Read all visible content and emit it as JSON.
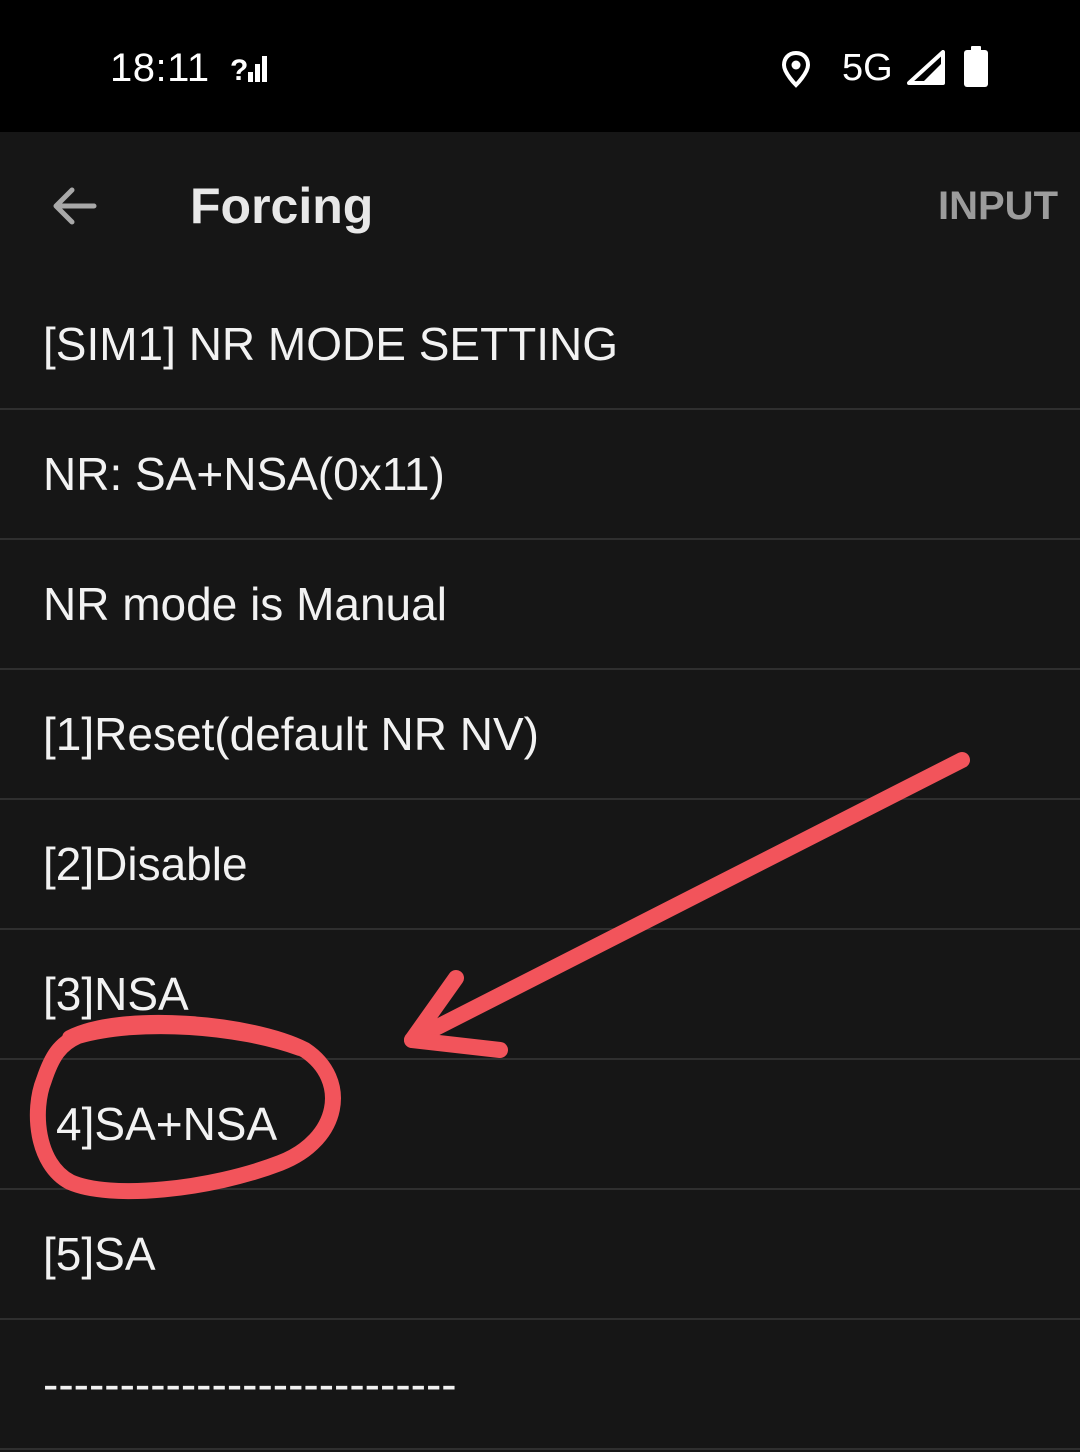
{
  "status_bar": {
    "time": "18:11",
    "network_type": "5G",
    "icons": [
      "signal-question-icon",
      "location-icon",
      "cell-signal-icon",
      "battery-icon"
    ]
  },
  "toolbar": {
    "title": "Forcing",
    "action_label": "INPUT",
    "back_icon": "arrow-left-icon"
  },
  "list": {
    "items": [
      {
        "label": "[SIM1] NR MODE SETTING"
      },
      {
        "label": "NR: SA+NSA(0x11)"
      },
      {
        "label": "NR mode is Manual"
      },
      {
        "label": "[1]Reset(default NR NV)"
      },
      {
        "label": "[2]Disable"
      },
      {
        "label": "[3]NSA"
      },
      {
        "label": "4]SA+NSA"
      },
      {
        "label": "[5]SA"
      },
      {
        "label": "---------------------------"
      }
    ]
  },
  "colors": {
    "background": "#161616",
    "status_bar": "#000000",
    "divider": "#2f2f2f",
    "annotation": "#f2545b",
    "action_text": "#9c9c9c"
  }
}
